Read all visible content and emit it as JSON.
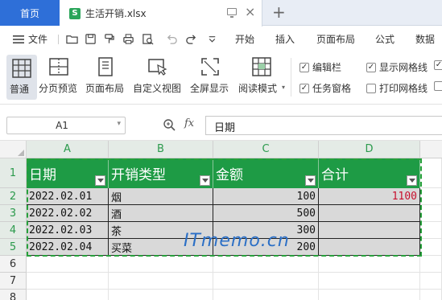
{
  "tabs": {
    "home_label": "首页",
    "file_name": "生活开销.xlsx",
    "file_icon_letter": "S",
    "close_glyph": "×",
    "add_glyph": "+"
  },
  "menu": {
    "file_label": "文件",
    "tabs": [
      "开始",
      "插入",
      "页面布局",
      "公式",
      "数据"
    ]
  },
  "ribbon": {
    "buttons": [
      "普通",
      "分页预览",
      "页面布局",
      "自定义视图",
      "全屏显示",
      "阅读模式"
    ],
    "checkboxes": [
      {
        "label": "编辑栏",
        "checked": true
      },
      {
        "label": "显示网格线",
        "checked": true
      },
      {
        "label": "任务窗格",
        "checked": true
      },
      {
        "label": "打印网格线",
        "checked": false
      }
    ]
  },
  "formula_bar": {
    "name_box": "A1",
    "fx_label": "fx",
    "content": "日期"
  },
  "sheet": {
    "columns": [
      "A",
      "B",
      "C",
      "D"
    ],
    "rows": [
      "1",
      "2",
      "3",
      "4",
      "5",
      "6",
      "7",
      "8"
    ],
    "headers": [
      "日期",
      "开销类型",
      "金额",
      "合计"
    ],
    "data": [
      [
        "2022.02.01",
        "烟",
        "100",
        "1100"
      ],
      [
        "2022.02.02",
        "酒",
        "500",
        ""
      ],
      [
        "2022.02.03",
        "茶",
        "300",
        ""
      ],
      [
        "2022.02.04",
        "买菜",
        "200",
        ""
      ]
    ],
    "watermark": "ITmemo.cn"
  },
  "colors": {
    "accent_blue": "#2e6fd8",
    "header_green": "#1e9b45",
    "total_red": "#c8102e"
  }
}
